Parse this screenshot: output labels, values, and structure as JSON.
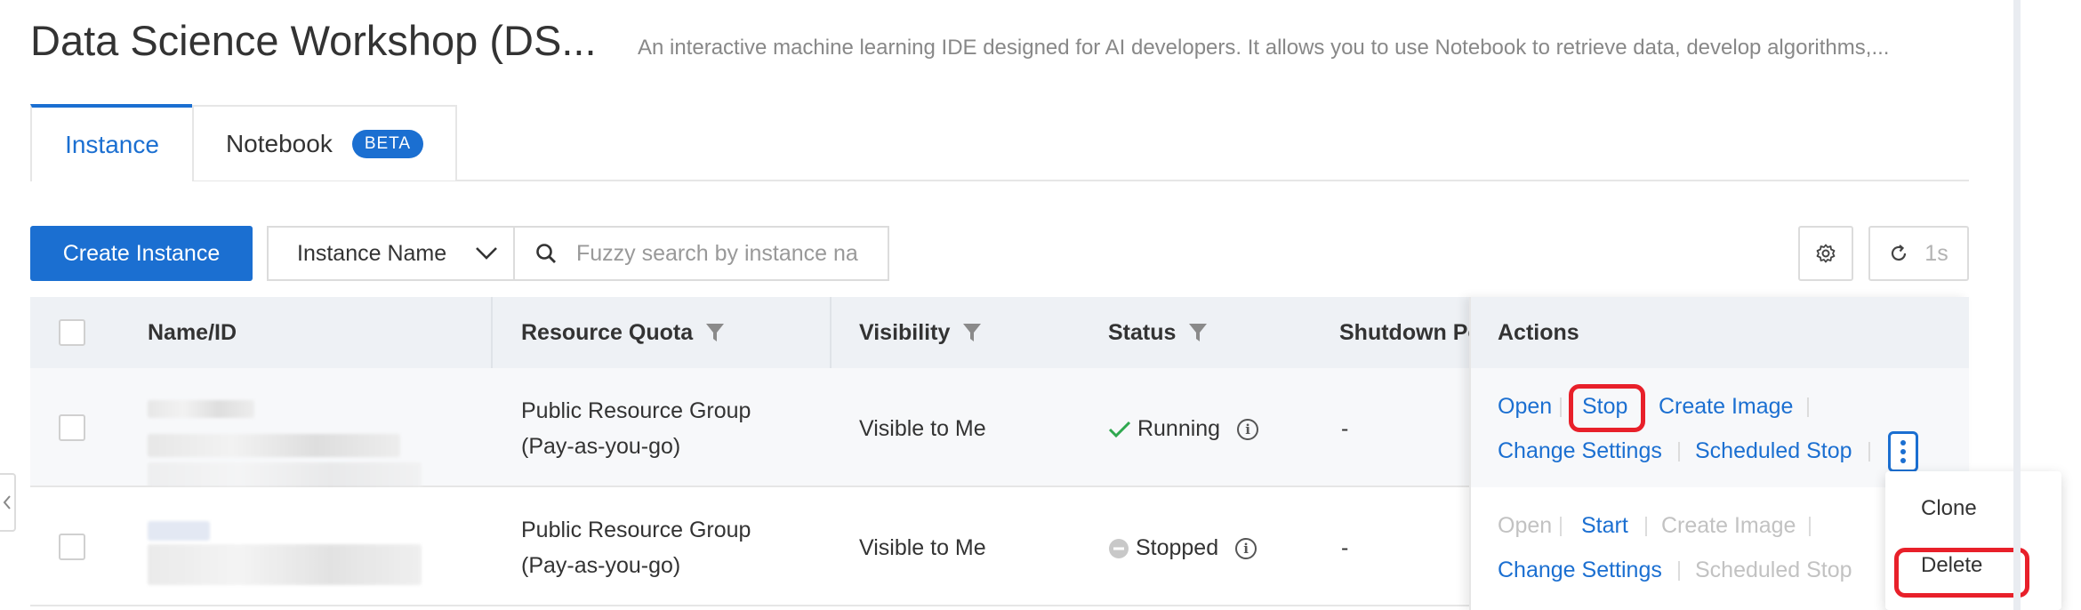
{
  "header": {
    "title": "Data Science Workshop (DS...",
    "description": "An interactive machine learning IDE designed for AI developers. It allows you to use Notebook to retrieve data, develop algorithms,..."
  },
  "tabs": [
    {
      "label": "Instance",
      "active": true
    },
    {
      "label": "Notebook",
      "badge": "BETA",
      "active": false
    }
  ],
  "toolbar": {
    "create_label": "Create Instance",
    "filter_select_value": "Instance Name",
    "search_placeholder": "Fuzzy search by instance na",
    "refresh_label": "1s"
  },
  "table": {
    "columns": [
      "Name/ID",
      "Resource Quota",
      "Visibility",
      "Status",
      "Shutdown Po",
      "Actions"
    ],
    "rows": [
      {
        "resource_quota_line1": "Public Resource Group",
        "resource_quota_line2": "(Pay-as-you-go)",
        "visibility": "Visible to Me",
        "status": "Running",
        "shutdown_policy": "-",
        "actions": {
          "open": "Open",
          "toggle": "Stop",
          "create_image": "Create Image",
          "change_settings": "Change Settings",
          "scheduled_stop": "Scheduled Stop"
        }
      },
      {
        "resource_quota_line1": "Public Resource Group",
        "resource_quota_line2": "(Pay-as-you-go)",
        "visibility": "Visible to Me",
        "status": "Stopped",
        "shutdown_policy": "-",
        "actions": {
          "open": "Open",
          "toggle": "Start",
          "create_image": "Create Image",
          "change_settings": "Change Settings",
          "scheduled_stop": "Scheduled Stop"
        }
      }
    ]
  },
  "more_menu": {
    "items": [
      "Clone",
      "Delete"
    ]
  },
  "colors": {
    "accent": "#1b6fd1",
    "running": "#2fa84f",
    "stopped": "#c8c8c8",
    "highlight": "#e8202a"
  },
  "icons": [
    "chevron-down-icon",
    "search-icon",
    "gear-icon",
    "refresh-icon",
    "filter-icon",
    "check-icon",
    "info-icon",
    "more-vertical-icon",
    "collapse-left-icon"
  ]
}
